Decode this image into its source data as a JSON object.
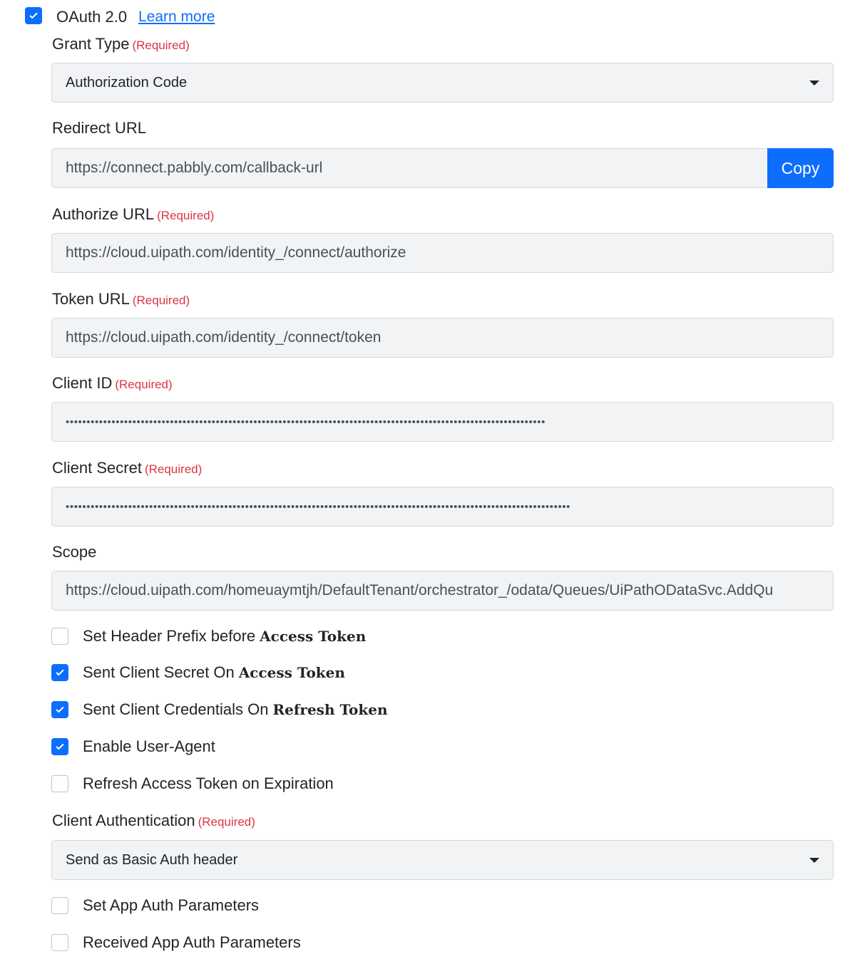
{
  "oauth": {
    "checked": true,
    "title": "OAuth 2.0",
    "learn_more": "Learn more"
  },
  "required_tag": "(Required)",
  "grant_type": {
    "label": "Grant Type",
    "value": "Authorization Code"
  },
  "redirect_url": {
    "label": "Redirect URL",
    "value": "https://connect.pabbly.com/callback-url",
    "copy_label": "Copy"
  },
  "authorize_url": {
    "label": "Authorize URL",
    "value": "https://cloud.uipath.com/identity_/connect/authorize"
  },
  "token_url": {
    "label": "Token URL",
    "value": "https://cloud.uipath.com/identity_/connect/token"
  },
  "client_id": {
    "label": "Client ID",
    "value": "•••••••••••••••••••••••••••••••••••••••••••••••••••••••••••••••••••••••••••••••••••••••••••••••••••••••••••••••••••"
  },
  "client_secret": {
    "label": "Client Secret",
    "value": "•••••••••••••••••••••••••••••••••••••••••••••••••••••••••••••••••••••••••••••••••••••••••••••••••••••••••••••••••••••••••"
  },
  "scope": {
    "label": "Scope",
    "value": "https://cloud.uipath.com/homeuaymtjh/DefaultTenant/orchestrator_/odata/Queues/UiPathODataSvc.AddQu"
  },
  "options": [
    {
      "text": "Set Header Prefix before",
      "bold": "Access Token",
      "checked": false
    },
    {
      "text": "Sent Client Secret On",
      "bold": "Access Token",
      "checked": true
    },
    {
      "text": "Sent Client Credentials On",
      "bold": "Refresh Token",
      "checked": true
    },
    {
      "text": "Enable User-Agent",
      "bold": "",
      "checked": true
    },
    {
      "text": "Refresh Access Token on Expiration",
      "bold": "",
      "checked": false
    }
  ],
  "client_auth": {
    "label": "Client Authentication",
    "value": "Send as Basic Auth header"
  },
  "app_options": [
    {
      "text": "Set App Auth Parameters",
      "checked": false
    },
    {
      "text": "Received App Auth Parameters",
      "checked": false
    }
  ],
  "colors": {
    "accent": "#0d6efd",
    "required": "#dc3545",
    "field_bg": "#f1f3f5"
  },
  "icons": {
    "check": "check-icon",
    "dropdown": "chevron-down-icon"
  }
}
